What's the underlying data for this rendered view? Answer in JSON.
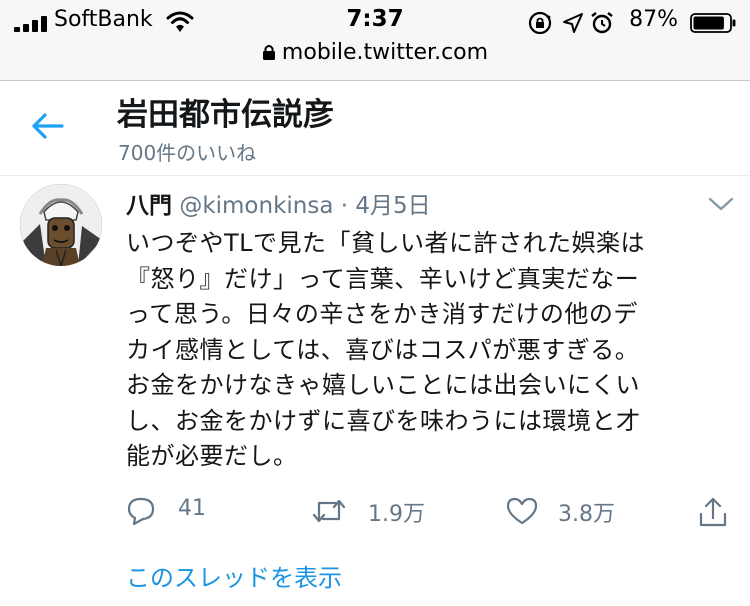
{
  "status_bar": {
    "carrier": "SoftBank",
    "time": "7:37",
    "battery_percent": "87%",
    "battery_level": 0.87,
    "icons": [
      "signal-icon",
      "wifi-icon",
      "rotation-lock-icon",
      "location-icon",
      "alarm-icon",
      "battery-icon"
    ]
  },
  "url_bar": {
    "url": "mobile.twitter.com",
    "icon": "lock-icon"
  },
  "header": {
    "title": "岩田都市伝説彦",
    "subtitle": "700件のいいね",
    "back_icon": "back-arrow-icon"
  },
  "tweet": {
    "name": "八門",
    "handle": "@kimonkinsa",
    "separator": "·",
    "date": "4月5日",
    "text_lines": [
      "いつぞやTLで見た「貧しい者に許された娯楽は",
      "『怒り』だけ」って言葉、辛いけど真実だなー",
      "って思う。日々の辛さをかき消すだけの他のデ",
      "カイ感情としては、喜びはコスパが悪すぎる。",
      "お金をかけなきゃ嬉しいことには出会いにくい",
      "し、お金をかけずに喜びを味わうには環境と才",
      "能が必要だし。"
    ],
    "actions": {
      "reply_count": "41",
      "retweet_count": "1.9万",
      "like_count": "3.8万"
    },
    "show_thread": "このスレッドを表示"
  },
  "colors": {
    "accent": "#1da1f2",
    "link": "#1b95e0",
    "muted": "#657786",
    "text": "#14171a"
  }
}
